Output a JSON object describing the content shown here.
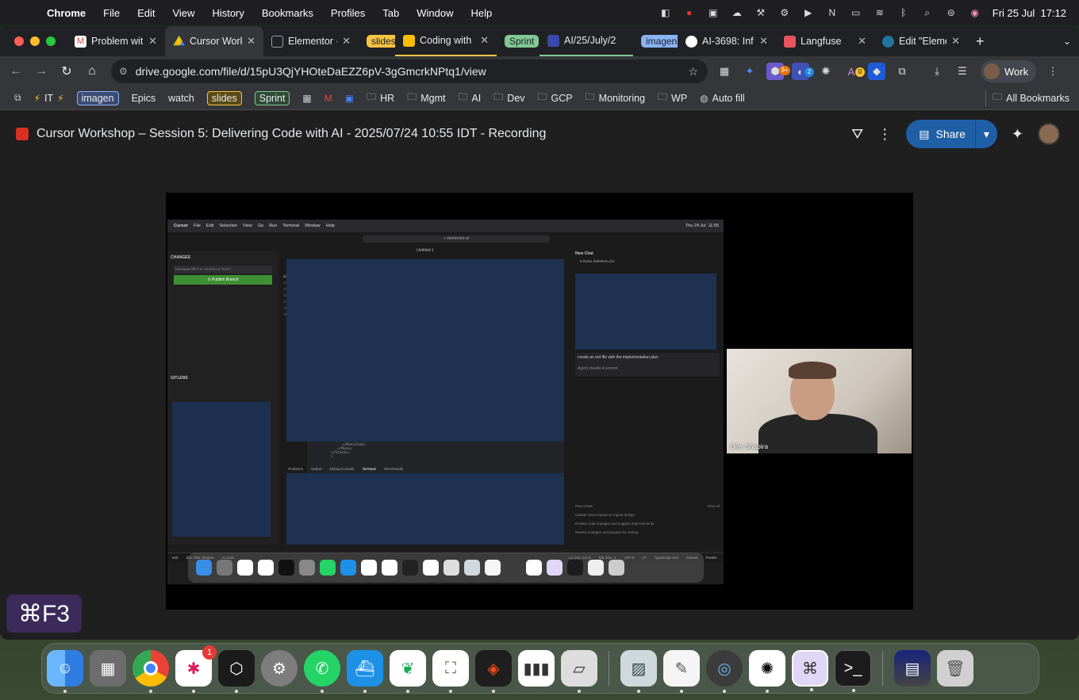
{
  "menubar": {
    "apple": "",
    "app": "Chrome",
    "items": [
      "File",
      "Edit",
      "View",
      "History",
      "Bookmarks",
      "Profiles",
      "Tab",
      "Window",
      "Help"
    ],
    "clock": "Fri 25 Jul  17:12"
  },
  "tabs": [
    {
      "label": "Problem wit",
      "fav": "#ea4335",
      "type": "gmail"
    },
    {
      "label": "Cursor Work",
      "fav": "#1a73e8",
      "type": "drive",
      "active": true
    },
    {
      "label": "Elementor -",
      "fav": "#9aa0a6",
      "type": "page"
    },
    {
      "pill": "slides",
      "pillColor": "#f6c443",
      "pillText": "#202124"
    },
    {
      "label": "Coding with",
      "fav": "#fbbc04",
      "type": "slides"
    },
    {
      "pill": "Sprint",
      "pillColor": "#81c995",
      "pillText": "#202124"
    },
    {
      "label": "AI/25/July/2",
      "fav": "#3949ab",
      "type": "jira"
    },
    {
      "pill": "imagen",
      "pillColor": "#8ab4f8",
      "pillText": "#202124"
    },
    {
      "label": "AI-3698: Inf",
      "fav": "#ffffff",
      "type": "github"
    },
    {
      "label": "Langfuse",
      "fav": "#e8555f",
      "type": "page"
    },
    {
      "label": "Edit \"Eleme",
      "fav": "#21759b",
      "type": "wp"
    }
  ],
  "toolbar": {
    "url": "drive.google.com/file/d/15pU3QjYHOteDaEZZ6pV-3gGmcrkNPtq1/view",
    "profile": "Work",
    "ext_badges": [
      "9+",
      "2",
      "0"
    ]
  },
  "bookmarks": {
    "items": [
      {
        "label": "IT",
        "kind": "pill-less",
        "icon": "⚡"
      },
      {
        "label": "imagen",
        "kind": "pill"
      },
      {
        "label": "Epics",
        "kind": "text"
      },
      {
        "label": "watch",
        "kind": "text"
      },
      {
        "label": "slides",
        "kind": "pill"
      },
      {
        "label": "Sprint",
        "kind": "pill"
      },
      {
        "label": "HR",
        "kind": "folder"
      },
      {
        "label": "Mgmt",
        "kind": "folder"
      },
      {
        "label": "AI",
        "kind": "folder"
      },
      {
        "label": "Dev",
        "kind": "folder"
      },
      {
        "label": "GCP",
        "kind": "folder"
      },
      {
        "label": "Monitoring",
        "kind": "folder"
      },
      {
        "label": "WP",
        "kind": "folder"
      },
      {
        "label": "Auto fill",
        "kind": "link"
      }
    ],
    "all": "All Bookmarks"
  },
  "viewer": {
    "title": "Cursor Workshop – Session 5: Delivering Code with AI - 2025/07/24 10:55 IDT - Recording",
    "share": "Share",
    "shortcut": "⌘F3"
  },
  "recording": {
    "menubar": [
      "Cursor",
      "File",
      "Edit",
      "Selection",
      "View",
      "Go",
      "Run",
      "Terminal",
      "Window",
      "Help"
    ],
    "clock": "Thu 24 Jul  11:05",
    "search": "⌕ elementor-ai",
    "tab": "Untitled-1",
    "changes": "CHANGES",
    "message_placeholder": "Message (⌘⏎ to commit on \"test\")",
    "publish": "⊙ Publish Branch",
    "gitlens": "GITLENS",
    "chat_title": "New Chat",
    "chat_tabs": "5 Rules   SideMenu.tsx",
    "prompt": "create an md file with the implementation plan",
    "agent": "Agent   claude-4-sonnet",
    "past_title": "Past Chats",
    "view_all": "View All",
    "past": [
      "Update menu based on Figma design",
      "Review code changes and suggest improvements",
      "Review changes and prepare for testing"
    ],
    "panel_tabs": [
      "Problems",
      "Output",
      "Debug Console",
      "Terminal",
      "Test Results"
    ],
    "code": [
      "</MenuItem>",
      "</Menu>",
      "</Stack>;",
      "}"
    ],
    "status": [
      "test",
      "Jira: Ofer Shapira",
      "AI-3115",
      "Ln 144, Col 9",
      "Tab Size: 4",
      "UTF-8",
      "LF",
      "TypeScript JSX",
      "Reload",
      "Prettier"
    ],
    "gutter": [
      "148",
      "149",
      "150",
      "151",
      "152",
      "153",
      "144"
    ],
    "participant": "Ofer Shapira"
  },
  "dock": {
    "apps": [
      {
        "name": "finder",
        "color": "#3a8ee6"
      },
      {
        "name": "launchpad",
        "color": "#6d6d6d"
      },
      {
        "name": "chrome",
        "color": "#ffffff"
      },
      {
        "name": "slack",
        "color": "#ffffff",
        "badge": "1"
      },
      {
        "name": "cursor",
        "color": "#1b1b1b"
      },
      {
        "name": "system-settings",
        "color": "#7d7d7d"
      },
      {
        "name": "whatsapp",
        "color": "#25d366"
      },
      {
        "name": "docker",
        "color": "#1d91e6"
      },
      {
        "name": "mongodb",
        "color": "#ffffff"
      },
      {
        "name": "ce-app",
        "color": "#ffffff"
      },
      {
        "name": "figma",
        "color": "#1e1e1e"
      },
      {
        "name": "istat",
        "color": "#ffffff"
      },
      {
        "name": "parallels",
        "color": "#dddddd"
      },
      {
        "name": "preview",
        "color": "#cfd8dc",
        "sep": true
      },
      {
        "name": "textedit",
        "color": "#f5f5f5"
      },
      {
        "name": "quicktime",
        "color": "#3c3c3c"
      },
      {
        "name": "chatgpt",
        "color": "#ffffff"
      },
      {
        "name": "keyboard",
        "color": "#e0d6f5"
      },
      {
        "name": "terminal",
        "color": "#1c1c1c"
      },
      {
        "name": "stack",
        "color": "#444",
        "sep": true
      },
      {
        "name": "trash",
        "color": "#d0d0d0"
      }
    ]
  }
}
